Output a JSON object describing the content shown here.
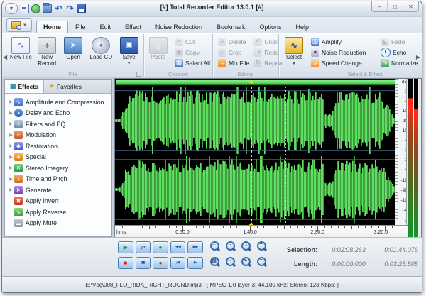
{
  "window": {
    "title": "[#] Total Recorder Editor 13.0.1 [#]",
    "controls": {
      "minimize": "–",
      "maximize": "□",
      "close": "✕"
    }
  },
  "tabs": {
    "items": [
      "Home",
      "File",
      "Edit",
      "Effect",
      "Noise Reduction",
      "Bookmark",
      "Options",
      "Help"
    ],
    "active": "Home"
  },
  "ribbon": {
    "groups": {
      "file": "File",
      "cliboard": "Cliboard",
      "editing": "Editing",
      "select_effect": "Select & Effect"
    },
    "buttons": {
      "new_file": "New File",
      "new_record": "New Record",
      "open": "Open",
      "load_cd": "Load CD",
      "save": "Save",
      "paste": "Paste",
      "cut": "Cut",
      "copy": "Copy",
      "select_all": "Select All",
      "delete": "Delete",
      "undo": "Undo",
      "crop": "Crop",
      "redo": "Redo",
      "mix_file": "Mix File",
      "repeat": "Repeat",
      "select": "Select",
      "amplify": "Amplify",
      "noise_reduction": "Noise Reduction",
      "speed_change": "Speed Change",
      "fade": "Fade",
      "echo": "Echo",
      "normalize": "Normalize",
      "effect": "Effect"
    }
  },
  "sidebar": {
    "tab_effects": "Effcets",
    "tab_favorites": "Favorites",
    "items": [
      {
        "label": "Amplitude and Compression"
      },
      {
        "label": "Delay and Echo"
      },
      {
        "label": "Filters and EQ"
      },
      {
        "label": "Modulation"
      },
      {
        "label": "Restoration"
      },
      {
        "label": "Special"
      },
      {
        "label": "Stereo Imagery"
      },
      {
        "label": "Time and Pitch"
      },
      {
        "label": "Generate"
      },
      {
        "label": "Apply Invert"
      },
      {
        "label": "Apply Reverse"
      },
      {
        "label": "Apply Mute"
      }
    ]
  },
  "waveform": {
    "scale_top": [
      "dB",
      "-1",
      "-4",
      "-10",
      "-90",
      "-10",
      "-4",
      "-1"
    ],
    "scale_bottom": [
      "-1",
      "-4",
      "-10",
      "-90",
      "-10",
      "-4",
      "-1"
    ],
    "ruler_unit": "hms",
    "ruler_ticks": [
      "0:50.0",
      "1:40.0",
      "2:30.0",
      "3:20.0"
    ]
  },
  "transport": {
    "play": "▶",
    "loop": "⇄",
    "record_ready": "●",
    "rewind": "◀◀",
    "forward": "▶▶",
    "stop": "■",
    "pause": "▮▮",
    "record": "●",
    "previous": "|◀",
    "next": "▶|"
  },
  "info": {
    "selection_label": "Selection:",
    "selection_pos": "0:02:08.263",
    "selection_len": "0:01:44.076",
    "length_label": "Length:",
    "length_pos": "0:00:00.000",
    "length_total": "0:03:25.505"
  },
  "statusbar": {
    "text": "E:\\Vóç\\008_FLO_RIDA_RIGHT_ROUND.mp3 - [ MPEG 1.0 layer-3: 44,100 kHz; Stereo; 128 Kbps;  ]"
  }
}
